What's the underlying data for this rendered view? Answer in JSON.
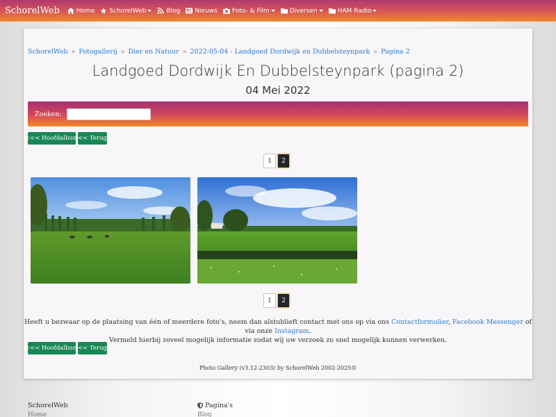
{
  "navbar": {
    "brand": "SchorelWeb",
    "items": [
      {
        "label": "Home",
        "icon": "home-icon",
        "dropdown": false
      },
      {
        "label": "SchorelWeb",
        "icon": "star-icon",
        "dropdown": true
      },
      {
        "label": "Blog",
        "icon": "rss-icon",
        "dropdown": false
      },
      {
        "label": "Nieuws",
        "icon": "newspaper-icon",
        "dropdown": false
      },
      {
        "label": "Foto- & Film",
        "icon": "camera-icon",
        "dropdown": true
      },
      {
        "label": "Diversen",
        "icon": "folder-icon",
        "dropdown": true
      },
      {
        "label": "HAM Radio",
        "icon": "folder-icon",
        "dropdown": true
      }
    ]
  },
  "breadcrumb": [
    "SchorelWeb",
    "Fotogallerij",
    "Dier en Natuur",
    "2022-05-04 - Landgoed Dordwijk en Dubbelsteynpark",
    "Pagina 2"
  ],
  "page": {
    "title": "Landgoed Dordwijk En Dubbelsteynpark (pagina 2)",
    "subtitle": "04 Mei 2022"
  },
  "search": {
    "label": "Zoeken:",
    "value": "",
    "placeholder": ""
  },
  "buttons": {
    "main_album": "<<< Hoofdalbum",
    "back": "<< Terug"
  },
  "pagination": {
    "pages": [
      "1",
      "2"
    ],
    "current": "2"
  },
  "notice": {
    "before": "Heeft u bezwaar op de plaatsing van één of meerdere foto's, neem dan alstublieft contact met ons op via ons ",
    "link1": "Contactformulier",
    "sep1": ", ",
    "link2": "Facebook Messenger",
    "mid": " of via onze ",
    "link3": "Instagram",
    "after": ".",
    "line2": "Vermeld hierbij zoveel mogelijk informatie zodat wij uw verzoek zo snel mogelijk kunnen verwerken."
  },
  "credit": "Photo Gallery (v3.12-2303) by SchorelWeb 2002-2025©",
  "footer": {
    "col1_title": "SchorelWeb",
    "col1_link": "Home",
    "col2_title": "Pagina's",
    "col2_icon": "shield-icon",
    "col2_link": "Blog"
  },
  "colors": {
    "accent_green": "#198754",
    "link_blue": "#2a7bd1",
    "nav_gradient_top": "#b03a6e",
    "nav_gradient_bottom": "#f08a2a"
  }
}
